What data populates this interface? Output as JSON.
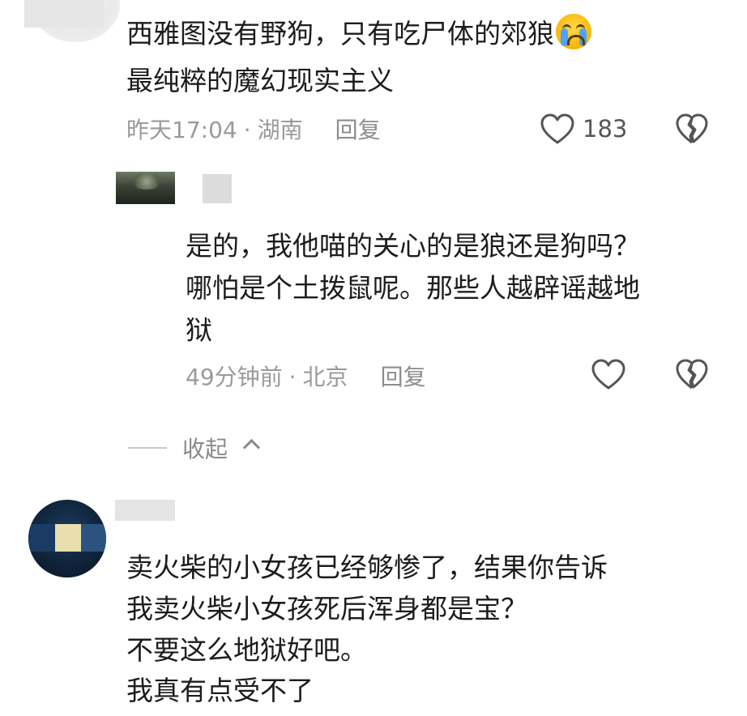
{
  "comment_1": {
    "text_line_1": "西雅图没有野狗，只有吃尸体的郊狼",
    "emoji": "loudly-crying-face-icon",
    "text_line_2": "最纯粹的魔幻现实主义",
    "time": "昨天17:04",
    "separator": "·",
    "location": "湖南",
    "reply_label": "回复",
    "like_count": "183"
  },
  "reply_1": {
    "text_line_1": "是的，我他喵的关心的是狼还是狗吗？",
    "text_line_2": "哪怕是个土拨鼠呢。那些人越辟谣越地",
    "text_line_3": "狱",
    "time": "49分钟前",
    "separator": "·",
    "location": "北京",
    "reply_label": "回复"
  },
  "collapse_label": "收起",
  "comment_2": {
    "text_line_1": "卖火柴的小女孩已经够惨了，结果你告诉",
    "text_line_2": "我卖火柴小女孩死后浑身都是宝？",
    "text_line_3": "不要这么地狱好吧。",
    "text_line_4": "我真有点受不了"
  },
  "colors": {
    "text": "#1c1c1c",
    "meta": "#9a9a9a",
    "icon": "#555555"
  }
}
